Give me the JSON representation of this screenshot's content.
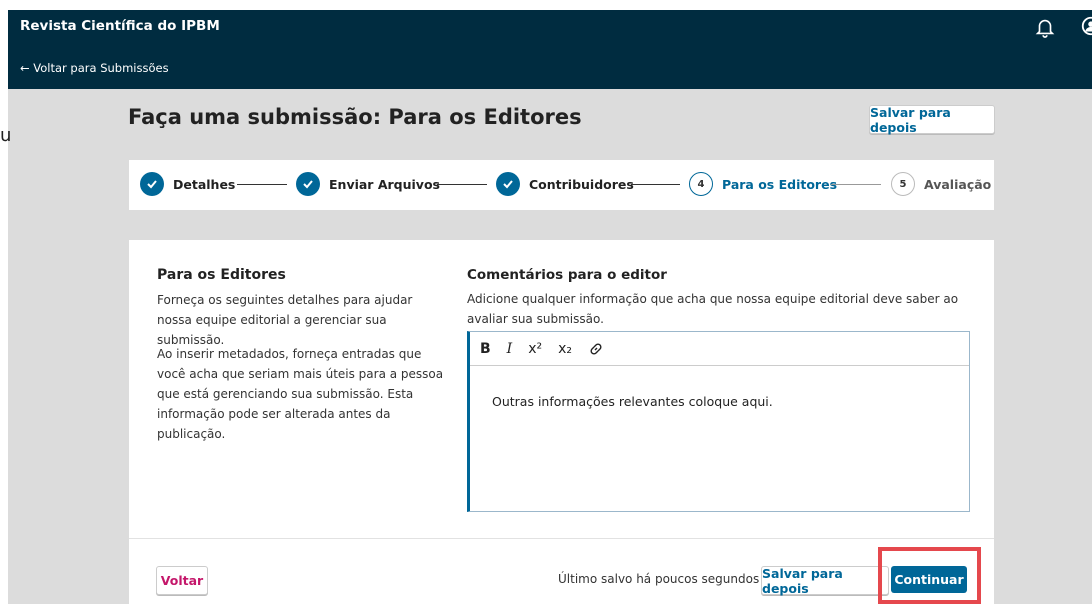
{
  "header": {
    "brand": "Revista Científica do IPBM",
    "back_link": "← Voltar para Submissões"
  },
  "page": {
    "left_mark": "u",
    "title": "Faça uma submissão: Para os Editores",
    "save_later": "Salvar para depois"
  },
  "steps": [
    {
      "label": "Detalhes",
      "state": "done"
    },
    {
      "label": "Enviar Arquivos",
      "state": "done"
    },
    {
      "label": "Contribuidores",
      "state": "done"
    },
    {
      "label": "Para os Editores",
      "number": "4",
      "state": "current"
    },
    {
      "label": "Avaliação",
      "number": "5",
      "state": "upcoming"
    }
  ],
  "section": {
    "heading": "Para os Editores",
    "desc1": "Forneça os seguintes detalhes para ajudar nossa equipe editorial a gerenciar sua submissão.",
    "desc2": "Ao inserir metadados, forneça entradas que você acha que seriam mais úteis para a pessoa que está gerenciando sua submissão. Esta informação pode ser alterada antes da publicação."
  },
  "comments": {
    "label": "Comentários para o editor",
    "help": "Adicione qualquer informação que acha que nossa equipe editorial deve saber ao avaliar sua submissão.",
    "toolbar": {
      "bold": "B",
      "italic": "I",
      "superscript": "x²",
      "subscript": "x₂"
    },
    "value": "Outras informações relevantes coloque aqui."
  },
  "footer": {
    "back": "Voltar",
    "last_saved": "Último salvo há poucos segundos",
    "save_later": "Salvar para depois",
    "continue": "Continuar"
  },
  "colors": {
    "header_bg": "#002c40",
    "primary": "#006798",
    "back_link": "#c4166a",
    "highlight": "#e5484d"
  }
}
